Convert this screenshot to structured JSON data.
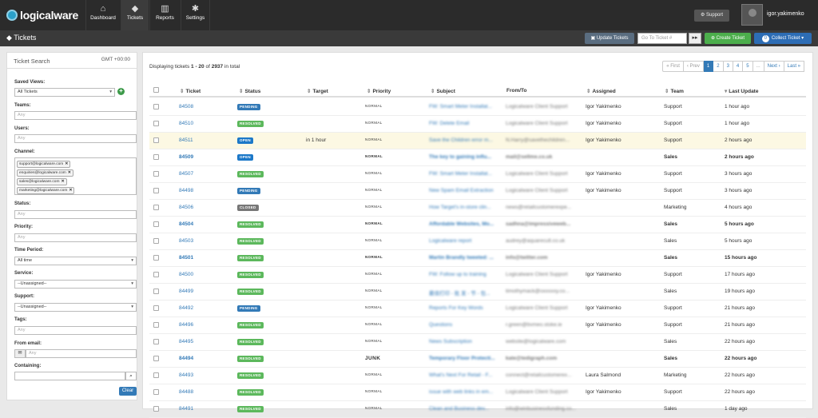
{
  "brand": {
    "name": "logicalware"
  },
  "nav": [
    {
      "label": "Dashboard",
      "icon": "home-icon"
    },
    {
      "label": "Tickets",
      "icon": "tags-icon"
    },
    {
      "label": "Reports",
      "icon": "bar-chart-icon"
    },
    {
      "label": "Settings",
      "icon": "gear-icon"
    }
  ],
  "header": {
    "support": "Support",
    "user": "igor.yakimenko"
  },
  "subbar": {
    "title": "Tickets",
    "update": "Update Tickets",
    "goto_placeholder": "Go To Ticket #",
    "create": "Create Ticket",
    "collect": "Collect Ticket",
    "collect_count": "0"
  },
  "search": {
    "title": "Ticket Search",
    "timezone": "GMT +00:00",
    "saved_views_label": "Saved Views:",
    "saved_views_value": "All Tickets",
    "teams_label": "Teams:",
    "users_label": "Users:",
    "channel_label": "Channel:",
    "channels": [
      "support@logicalware.com",
      "enquiries@logicalware.com",
      "sales@logicalware.com",
      "marketing@logicalware.com"
    ],
    "status_label": "Status:",
    "priority_label": "Priority:",
    "time_label": "Time Period:",
    "time_value": "All time",
    "service_label": "Service:",
    "service_value": "--Unassigned--",
    "support_label": "Support:",
    "support_value": "--Unassigned--",
    "tags_label": "Tags:",
    "from_label": "From email:",
    "containing_label": "Containing:",
    "any": "Any",
    "clear": "Clear"
  },
  "summary": {
    "prefix": "Displaying tickets",
    "range": "1 - 20",
    "of": "of",
    "total": "2937",
    "suffix": "in total"
  },
  "pager": [
    "« First",
    "‹ Prev",
    "1",
    "2",
    "3",
    "4",
    "5",
    "...",
    "Next ›",
    "Last »"
  ],
  "columns": {
    "ticket": "Ticket",
    "status": "Status",
    "target": "Target",
    "priority": "Priority",
    "subject": "Subject",
    "fromto": "From/To",
    "assigned": "Assigned",
    "team": "Team",
    "updated": "Last Update"
  },
  "rows": [
    {
      "id": "84508",
      "status": "PENDING",
      "target": "",
      "priority": "NORMAL",
      "subject": "FW: Smart Meter Installat...",
      "from": "Logicalware Client Support",
      "assigned": "Igor Yakimenko",
      "team": "Support",
      "updated": "1 hour ago",
      "bold": false,
      "hl": false
    },
    {
      "id": "84510",
      "status": "RESOLVED",
      "target": "",
      "priority": "NORMAL",
      "subject": "FW: Delete Email",
      "from": "Logicalware Client Support",
      "assigned": "Igor Yakimenko",
      "team": "Support",
      "updated": "1 hour ago",
      "bold": false,
      "hl": false
    },
    {
      "id": "84511",
      "status": "OPEN",
      "target": "in 1 hour",
      "priority": "NORMAL",
      "subject": "Save the Children error m...",
      "from": "N.Harry@savethechildren...",
      "assigned": "Igor Yakimenko",
      "team": "Support",
      "updated": "2 hours ago",
      "bold": false,
      "hl": true
    },
    {
      "id": "84509",
      "status": "OPEN",
      "target": "",
      "priority": "NORMAL",
      "subject": "The key to gaining influ...",
      "from": "mail@sellme.co.uk",
      "assigned": "",
      "team": "Sales",
      "updated": "2 hours ago",
      "bold": true,
      "hl": false
    },
    {
      "id": "84507",
      "status": "RESOLVED",
      "target": "",
      "priority": "NORMAL",
      "subject": "FW: Smart Meter Installat...",
      "from": "Logicalware Client Support",
      "assigned": "Igor Yakimenko",
      "team": "Support",
      "updated": "3 hours ago",
      "bold": false,
      "hl": false
    },
    {
      "id": "84498",
      "status": "PENDING",
      "target": "",
      "priority": "NORMAL",
      "subject": "New Spam Email Extraction",
      "from": "Logicalware Client Support",
      "assigned": "Igor Yakimenko",
      "team": "Support",
      "updated": "3 hours ago",
      "bold": false,
      "hl": false
    },
    {
      "id": "84506",
      "status": "CLOSED",
      "target": "",
      "priority": "NORMAL",
      "subject": "How Target's in-store clin...",
      "from": "news@retailcustomerexpe...",
      "assigned": "",
      "team": "Marketing",
      "updated": "4 hours ago",
      "bold": false,
      "hl": false
    },
    {
      "id": "84504",
      "status": "RESOLVED",
      "target": "",
      "priority": "NORMAL",
      "subject": "Affordable Websites, Mo...",
      "from": "sadhna@impressiveweb...",
      "assigned": "",
      "team": "Sales",
      "updated": "5 hours ago",
      "bold": true,
      "hl": false
    },
    {
      "id": "84503",
      "status": "RESOLVED",
      "target": "",
      "priority": "NORMAL",
      "subject": "Logicalware report",
      "from": "audrey@aquarecult.co.uk",
      "assigned": "",
      "team": "Sales",
      "updated": "5 hours ago",
      "bold": false,
      "hl": false
    },
    {
      "id": "84501",
      "status": "RESOLVED",
      "target": "",
      "priority": "NORMAL",
      "subject": "Martin Brandly tweeted: ...",
      "from": "info@twitter.com",
      "assigned": "",
      "team": "Sales",
      "updated": "15 hours ago",
      "bold": true,
      "hl": false
    },
    {
      "id": "84500",
      "status": "RESOLVED",
      "target": "",
      "priority": "NORMAL",
      "subject": "FW: Follow up to training",
      "from": "Logicalware Client Support",
      "assigned": "Igor Yakimenko",
      "team": "Support",
      "updated": "17 hours ago",
      "bold": false,
      "hl": false
    },
    {
      "id": "84499",
      "status": "RESOLVED",
      "target": "",
      "priority": "NORMAL",
      "subject": "最佳打印 - 批 发 - 节 - 包...",
      "from": "timothymack@oxxxxxy.co...",
      "assigned": "",
      "team": "Sales",
      "updated": "19 hours ago",
      "bold": false,
      "hl": false
    },
    {
      "id": "84492",
      "status": "PENDING",
      "target": "",
      "priority": "NORMAL",
      "subject": "Reports For Key Words",
      "from": "Logicalware Client Support",
      "assigned": "Igor Yakimenko",
      "team": "Support",
      "updated": "21 hours ago",
      "bold": false,
      "hl": false
    },
    {
      "id": "84496",
      "status": "RESOLVED",
      "target": "",
      "priority": "NORMAL",
      "subject": "Questions",
      "from": "r.green@bvmeo.stoke.ie",
      "assigned": "Igor Yakimenko",
      "team": "Support",
      "updated": "21 hours ago",
      "bold": false,
      "hl": false
    },
    {
      "id": "84495",
      "status": "RESOLVED",
      "target": "",
      "priority": "NORMAL",
      "subject": "News Subscription",
      "from": "website@logicalware.com",
      "assigned": "",
      "team": "Sales",
      "updated": "22 hours ago",
      "bold": false,
      "hl": false
    },
    {
      "id": "84494",
      "status": "RESOLVED",
      "target": "",
      "priority": "JUNK",
      "subject": "Temporary Floor Protecti...",
      "from": "kate@tedigraph.com",
      "assigned": "",
      "team": "Sales",
      "updated": "22 hours ago",
      "bold": true,
      "hl": false
    },
    {
      "id": "84493",
      "status": "RESOLVED",
      "target": "",
      "priority": "NORMAL",
      "subject": "What's Next For Retail - F...",
      "from": "connect@retailcustomerex...",
      "assigned": "Laura Salmond",
      "team": "Marketing",
      "updated": "22 hours ago",
      "bold": false,
      "hl": false
    },
    {
      "id": "84488",
      "status": "RESOLVED",
      "target": "",
      "priority": "NORMAL",
      "subject": "issue with web links in em...",
      "from": "Logicalware Client Support",
      "assigned": "Igor Yakimenko",
      "team": "Support",
      "updated": "22 hours ago",
      "bold": false,
      "hl": false
    },
    {
      "id": "84491",
      "status": "RESOLVED",
      "target": "",
      "priority": "NORMAL",
      "subject": "Clean and Business dev...",
      "from": "info@winbusinessfunding.co...",
      "assigned": "",
      "team": "Sales",
      "updated": "1 day ago",
      "bold": false,
      "hl": false
    }
  ]
}
